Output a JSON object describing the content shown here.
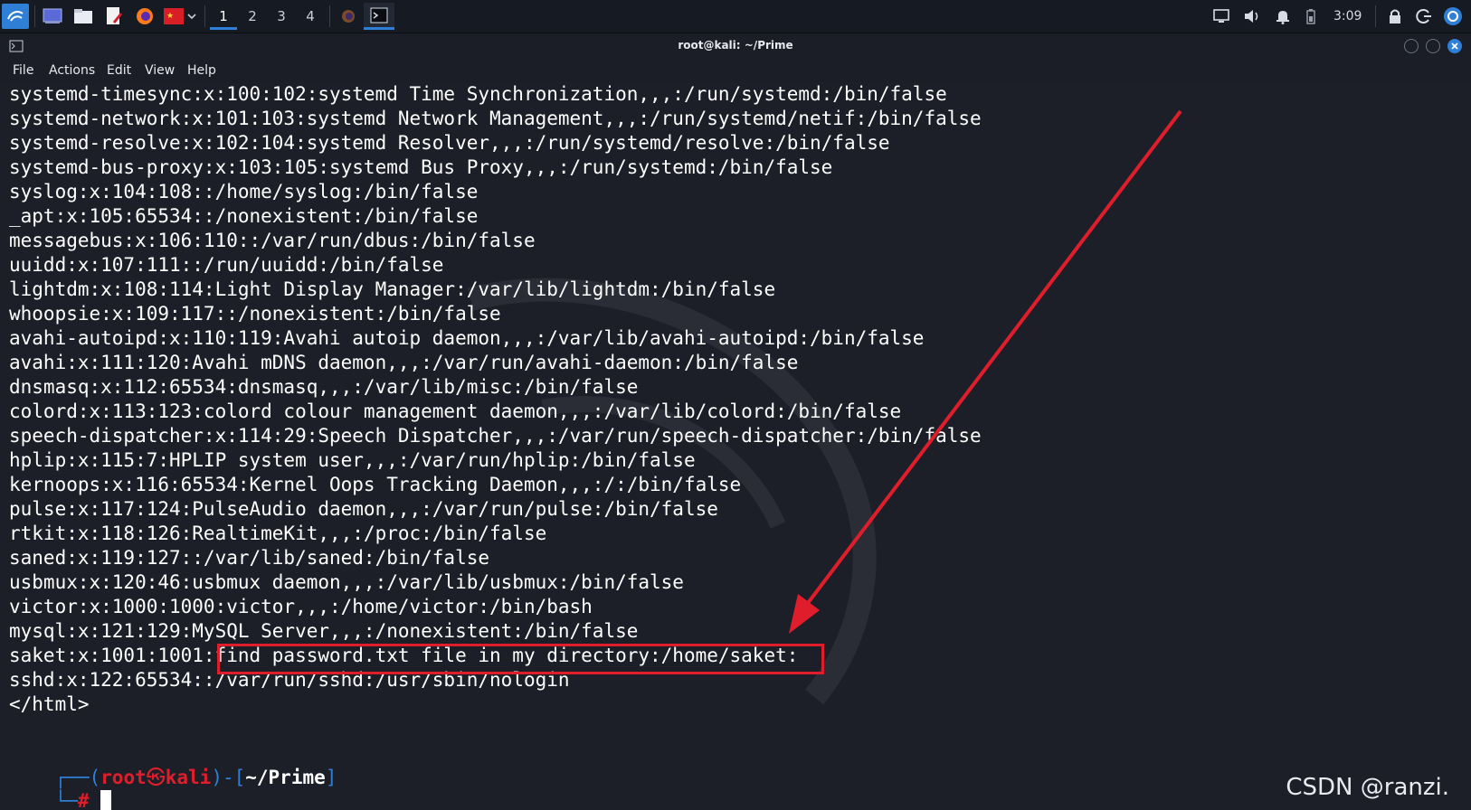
{
  "panel": {
    "workspaces": [
      "1",
      "2",
      "3",
      "4"
    ],
    "active_workspace": "1",
    "clock": "3:09",
    "icons": [
      "kali-menu-icon",
      "desktop-icon",
      "file-manager-icon",
      "text-editor-icon",
      "firefox-icon",
      "terminal-launcher-icon",
      "chevron-down-icon",
      "firefox-task-icon",
      "terminal-task-icon",
      "screen-icon",
      "volume-icon",
      "notification-bell-icon",
      "battery-icon",
      "lock-icon",
      "logout-icon",
      "user-icon"
    ]
  },
  "window": {
    "title": "root@kali: ~/Prime"
  },
  "menu": {
    "file": "File",
    "actions": "Actions",
    "edit": "Edit",
    "view": "View",
    "help": "Help"
  },
  "terminal": {
    "lines": [
      "systemd-timesync:x:100:102:systemd Time Synchronization,,,:/run/systemd:/bin/false",
      "systemd-network:x:101:103:systemd Network Management,,,:/run/systemd/netif:/bin/false",
      "systemd-resolve:x:102:104:systemd Resolver,,,:/run/systemd/resolve:/bin/false",
      "systemd-bus-proxy:x:103:105:systemd Bus Proxy,,,:/run/systemd:/bin/false",
      "syslog:x:104:108::/home/syslog:/bin/false",
      "_apt:x:105:65534::/nonexistent:/bin/false",
      "messagebus:x:106:110::/var/run/dbus:/bin/false",
      "uuidd:x:107:111::/run/uuidd:/bin/false",
      "lightdm:x:108:114:Light Display Manager:/var/lib/lightdm:/bin/false",
      "whoopsie:x:109:117::/nonexistent:/bin/false",
      "avahi-autoipd:x:110:119:Avahi autoip daemon,,,:/var/lib/avahi-autoipd:/bin/false",
      "avahi:x:111:120:Avahi mDNS daemon,,,:/var/run/avahi-daemon:/bin/false",
      "dnsmasq:x:112:65534:dnsmasq,,,:/var/lib/misc:/bin/false",
      "colord:x:113:123:colord colour management daemon,,,:/var/lib/colord:/bin/false",
      "speech-dispatcher:x:114:29:Speech Dispatcher,,,:/var/run/speech-dispatcher:/bin/false",
      "hplip:x:115:7:HPLIP system user,,,:/var/run/hplip:/bin/false",
      "kernoops:x:116:65534:Kernel Oops Tracking Daemon,,,:/:/bin/false",
      "pulse:x:117:124:PulseAudio daemon,,,:/var/run/pulse:/bin/false",
      "rtkit:x:118:126:RealtimeKit,,,:/proc:/bin/false",
      "saned:x:119:127::/var/lib/saned:/bin/false",
      "usbmux:x:120:46:usbmux daemon,,,:/var/lib/usbmux:/bin/false",
      "victor:x:1000:1000:victor,,,:/home/victor:/bin/bash",
      "mysql:x:121:129:MySQL Server,,,:/nonexistent:/bin/false",
      "saket:x:1001:1001:find password.txt file in my directory:/home/saket:",
      "sshd:x:122:65534::/var/run/sshd:/usr/sbin/nologin",
      "</html>"
    ],
    "prompt": {
      "open": "┌──(",
      "user": "root",
      "at": "㉿",
      "host": "kali",
      "mid": ")-[",
      "path": "~/Prime",
      "close": "]",
      "line2": "└─",
      "hash": "#"
    }
  },
  "annotation": {
    "highlighted_text": "find password.txt file in my directory:/home/saket:",
    "color": "#e01e2b"
  },
  "watermark_text": "CSDN @ranzi."
}
